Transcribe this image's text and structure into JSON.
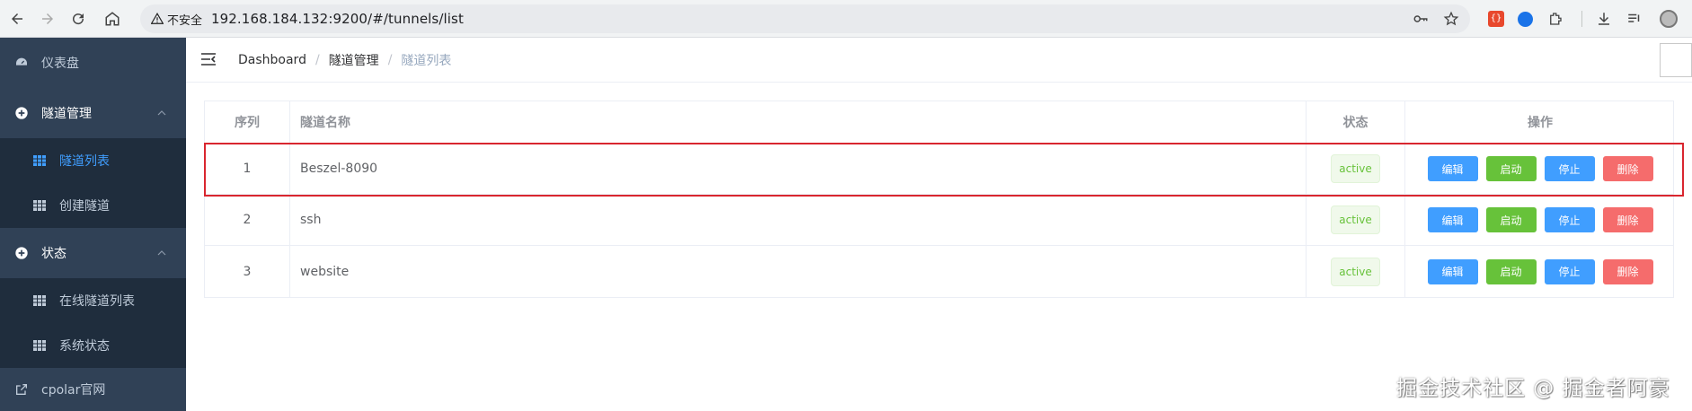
{
  "browser": {
    "security_label": "不安全",
    "url": "192.168.184.132:9200/#/tunnels/list"
  },
  "sidebar": {
    "items": [
      {
        "label": "仪表盘",
        "icon": "dashboard-icon"
      },
      {
        "label": "隧道管理",
        "icon": "plus-circle-icon",
        "expanded": true
      },
      {
        "label": "隧道列表",
        "icon": "grid-icon",
        "active": true
      },
      {
        "label": "创建隧道",
        "icon": "grid-icon"
      },
      {
        "label": "状态",
        "icon": "plus-circle-icon",
        "expanded": true
      },
      {
        "label": "在线隧道列表",
        "icon": "grid-icon"
      },
      {
        "label": "系统状态",
        "icon": "grid-icon"
      },
      {
        "label": "cpolar官网",
        "icon": "external-link-icon"
      }
    ]
  },
  "breadcrumb": {
    "items": [
      "Dashboard",
      "隧道管理",
      "隧道列表"
    ],
    "separator": "/"
  },
  "table": {
    "headers": [
      "序列",
      "隧道名称",
      "状态",
      "操作"
    ],
    "rows": [
      {
        "index": "1",
        "name": "Beszel-8090",
        "status": "active"
      },
      {
        "index": "2",
        "name": "ssh",
        "status": "active"
      },
      {
        "index": "3",
        "name": "website",
        "status": "active"
      }
    ],
    "actions": {
      "edit": "编辑",
      "start": "启动",
      "stop": "停止",
      "delete": "删除"
    }
  },
  "watermark": "掘金技术社区 @ 掘金者阿豪",
  "colors": {
    "sidebar_bg": "#304156",
    "submenu_bg": "#1f2d3d",
    "active_text": "#409eff",
    "primary": "#409eff",
    "success": "#67c23a",
    "danger": "#f56c6c",
    "highlight_border": "#d9262f"
  }
}
